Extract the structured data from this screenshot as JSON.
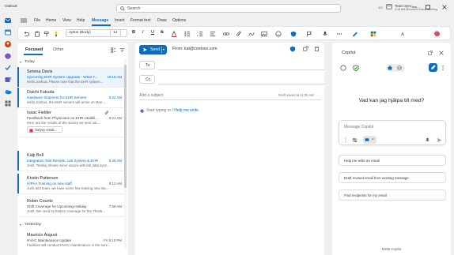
{
  "window": {
    "app_title": "Outlook",
    "search_placeholder": "Search"
  },
  "account": {
    "name": "Team Sync",
    "sub": "4:15 AM Microsoft Teams Meeting",
    "count": "1/2"
  },
  "menu": [
    "File",
    "Home",
    "View",
    "Help",
    "Message",
    "Insert",
    "Format text",
    "Draw",
    "Options"
  ],
  "ribbon": {
    "font": "Aptos (Body)",
    "size": "14"
  },
  "mail_tabs": {
    "focused": "Focused",
    "other": "Other"
  },
  "groups": {
    "today": "Today",
    "yesterday": "Yesterday"
  },
  "mails": [
    {
      "sender": "Serena Davis",
      "subject": "Upcoming EHR System Upgrade - What Y...",
      "time": "10:16 AM",
      "preview": "Hello Joshua, Please note that the EHR system...",
      "selected": true
    },
    {
      "sender": "Daichi Fukuda",
      "subject": "Hardware Shipment for EHR Servers",
      "time": "9:32 AM",
      "preview": "Hello Joshua, the EHR servers will arrive on Mon...",
      "selected": false
    },
    {
      "sender": "Isaac Fielder",
      "subject": "Feedback from Physicians on EHR Usabili...",
      "time": "9:21 AM",
      "preview": "Here are the results of the survey we sent out...",
      "selected": false,
      "attachment": "Survey result..."
    },
    {
      "sender": "Katji Bell",
      "subject": "Integration Test Results: Lab System & EHR",
      "time": "8:45 AM",
      "preview": "Josh, Testing shows minor issues with lab data sync...",
      "selected": false
    },
    {
      "sender": "Kristin Patterson",
      "subject": "HIPAA Training on new staff",
      "time": "8:12 AM",
      "preview": "Josh and team, we have some few training new sta...",
      "selected": false
    },
    {
      "sender": "Robin Counts",
      "subject": "Shift Coverage for Upcoming Holiday",
      "time": "7:58 AM",
      "preview": "Josh, We need to finalize coverage for the Thank...",
      "selected": false,
      "read": true
    },
    {
      "sender": "Mauricio August",
      "subject": "HVAC Maintenance Update",
      "time": "Fri 5:10 PM",
      "preview": "Facilities will conduct HVAC maintenance in the serv...",
      "selected": false,
      "read": true
    }
  ],
  "compose": {
    "send": "Send",
    "from": "From: kat@contoso.com",
    "to": "To",
    "cc": "Cc",
    "subject_placeholder": "Add a subject",
    "draft_saved": "Draft saved at 11:05 AM",
    "body_placeholder": "Start typing or ",
    "body_link": "/ Help me write"
  },
  "copilot": {
    "title": "Copilot",
    "greeting": "Vad kan jag hjälpa till med?",
    "input_placeholder": "Message Copilot",
    "suggestions": [
      "Help me write an email",
      "Draft revised email from existing message",
      "Find recipients for my email"
    ],
    "footer": "M365 Copilot"
  },
  "colors": {
    "accent": "#0f6cbd",
    "selected_row": "#ebf3fc",
    "app_bg": "#f0f0f0"
  }
}
